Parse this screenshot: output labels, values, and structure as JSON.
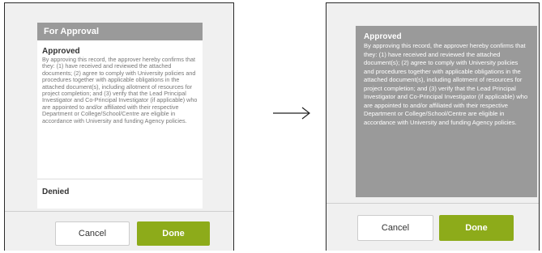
{
  "before": {
    "header": "For Approval",
    "approved_title": "Approved",
    "approved_desc": "By approving this record, the approver hereby confirms that they: (1) have received and reviewed the attached documents; (2) agree to comply with University policies and procedures together with applicable obligations in the attached document(s), including allotment of resources for project completion; and (3) verify that the Lead Principal Investigator and Co-Principal Investigator (if applicable) who are appointed to and/or affiliated with their respective Department or College/School/Centre are eligible in accordance with University and funding Agency policies.",
    "denied_title": "Denied",
    "cancel_label": "Cancel",
    "done_label": "Done"
  },
  "after": {
    "approved_title": "Approved",
    "approved_desc": "By approving this record, the approver hereby confirms that they: (1) have received and reviewed the attached document(s); (2) agree to comply with University policies and procedures together with applicable obligations in the attached document(s), including allotment of resources for project completion; and (3) verify that the Lead Principal Investigator and Co-Principal Investigator (if applicable) who are appointed to and/or affiliated with their respective Department or College/School/Centre are eligible in accordance with University and funding Agency policies.",
    "cancel_label": "Cancel",
    "done_label": "Done"
  },
  "icons": {
    "arrow": "arrow-right-icon"
  },
  "colors": {
    "header_gray": "#9a9a9a",
    "done_green": "#8dab1a",
    "panel_bg": "#f0f0f0"
  }
}
